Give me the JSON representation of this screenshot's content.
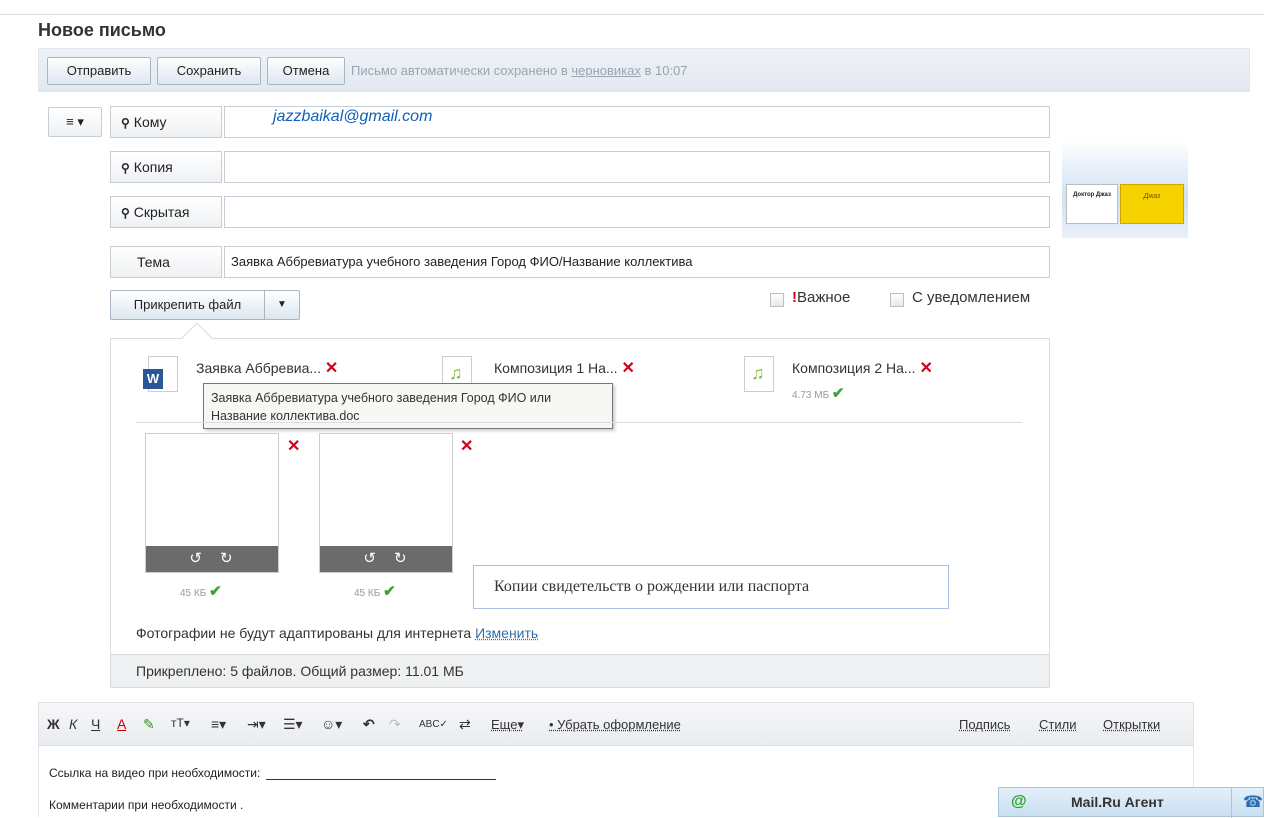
{
  "page_title": "Новое письмо",
  "toolbar": {
    "send_label": "Отправить",
    "save_label": "Сохранить",
    "cancel_label": "Отмена",
    "autosave_prefix": "Письмо автоматически сохранено в ",
    "autosave_link": "черновиках",
    "autosave_suffix": " в 10:07"
  },
  "menu_button_label": "≡ ▾",
  "fields": {
    "to_label": "Кому",
    "to_value": "jazzbaikal@gmail.com",
    "cc_label": "Копия",
    "cc_value": "",
    "bcc_label": "Скрытая",
    "bcc_value": "",
    "subject_label": "Тема",
    "subject_value": "Заявка Аббревиатура учебного заведения Город ФИО/Название коллектива"
  },
  "ad": {
    "left_text": "Доктор Джаз",
    "right_text": "Джаз"
  },
  "attach": {
    "button_label": "Прикрепить файл",
    "important_label": "Важное",
    "notify_label": "С уведомлением",
    "files": [
      {
        "name": "Заявка Аббревиа...",
        "size": ""
      },
      {
        "name": "Композиция 1 На...",
        "size": ""
      },
      {
        "name": "Композиция 2 На...",
        "size": "4.73 МБ"
      }
    ],
    "tooltip_text": "Заявка Аббревиатура учебного заведения Город ФИО или Название коллектива.doc",
    "photos": [
      {
        "size": "45 КБ"
      },
      {
        "size": "45 КБ"
      }
    ],
    "callout_text": "Копии свидетельств о рождении или паспорта",
    "photo_note": "Фотографии не будут адаптированы для интернета ",
    "photo_change_link": "Изменить",
    "summary": "Прикреплено: 5 файлов. Общий размер: 11.01 МБ"
  },
  "format_bar": {
    "bold": "Ж",
    "italic": "К",
    "underline": "Ч",
    "text_color": "А",
    "highlight": "✎",
    "font_size": "тТ▾",
    "align": "≡▾",
    "indent": "⇥▾",
    "list": "☰▾",
    "emoji": "☺▾",
    "undo": "↶",
    "redo": "↷",
    "spellcheck": "ABC✓",
    "translit": "⇄",
    "more": "Еще▾",
    "clear_format": "• Убрать оформление",
    "signature": "Подпись",
    "styles": "Стили",
    "postcards": "Открытки"
  },
  "body": {
    "line1": "Ссылка на видео при необходимости: ",
    "line2": "Комментарии при необходимости ."
  },
  "agent": {
    "at": "@",
    "label": "Mail.Ru Агент",
    "phone": "☎"
  }
}
